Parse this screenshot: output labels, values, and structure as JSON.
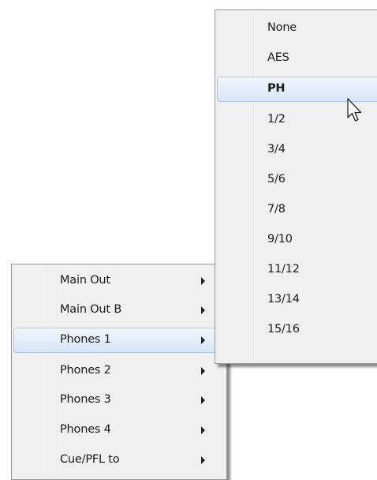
{
  "main_menu": {
    "items": [
      {
        "label": "Main Out",
        "has_submenu": true
      },
      {
        "label": "Main Out B",
        "has_submenu": true
      },
      {
        "label": "Phones 1",
        "has_submenu": true,
        "highlighted": true
      },
      {
        "label": "Phones 2",
        "has_submenu": true
      },
      {
        "label": "Phones 3",
        "has_submenu": true
      },
      {
        "label": "Phones 4",
        "has_submenu": true
      },
      {
        "label": "Cue/PFL to",
        "has_submenu": true
      }
    ]
  },
  "submenu": {
    "items": [
      {
        "label": "None"
      },
      {
        "label": "AES"
      },
      {
        "label": "PH",
        "highlighted": true,
        "bold": true
      },
      {
        "label": "1/2"
      },
      {
        "label": "3/4"
      },
      {
        "label": "5/6"
      },
      {
        "label": "7/8"
      },
      {
        "label": "9/10"
      },
      {
        "label": "11/12"
      },
      {
        "label": "13/14"
      },
      {
        "label": "15/16"
      }
    ]
  },
  "colors": {
    "menu_background": "#f0f0f0",
    "menu_border": "#979797",
    "highlight_border": "#a8c8ec",
    "highlight_fill": "#e4eefa"
  },
  "icons": {
    "cursor": "mouse-pointer-icon",
    "submenu_arrow": "chevron-right-icon"
  }
}
